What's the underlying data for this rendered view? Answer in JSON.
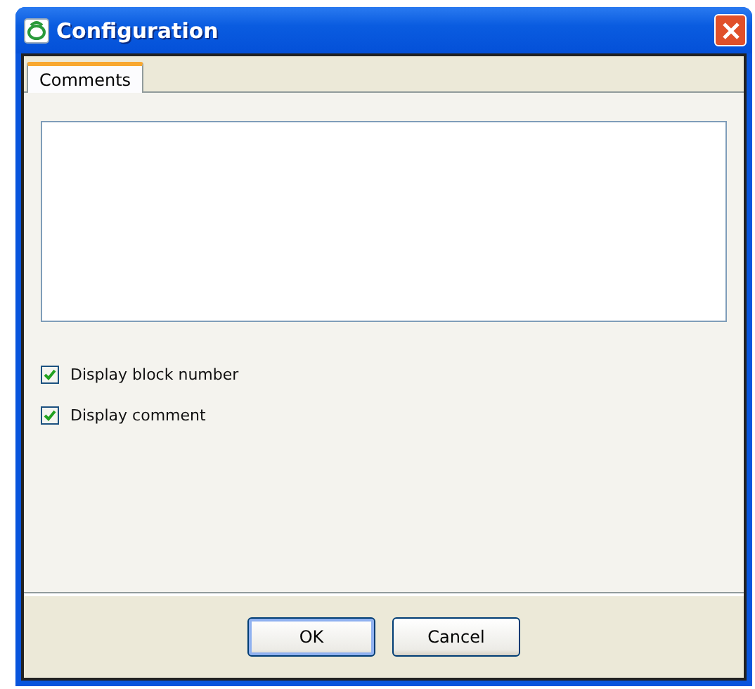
{
  "window": {
    "title": "Configuration"
  },
  "tabs": [
    {
      "label": "Comments",
      "selected": true
    }
  ],
  "options": [
    {
      "label": "Display block number",
      "checked": true
    },
    {
      "label": "Display comment",
      "checked": true
    }
  ],
  "buttons": [
    {
      "label": "OK",
      "default": true
    },
    {
      "label": "Cancel",
      "default": false
    }
  ]
}
